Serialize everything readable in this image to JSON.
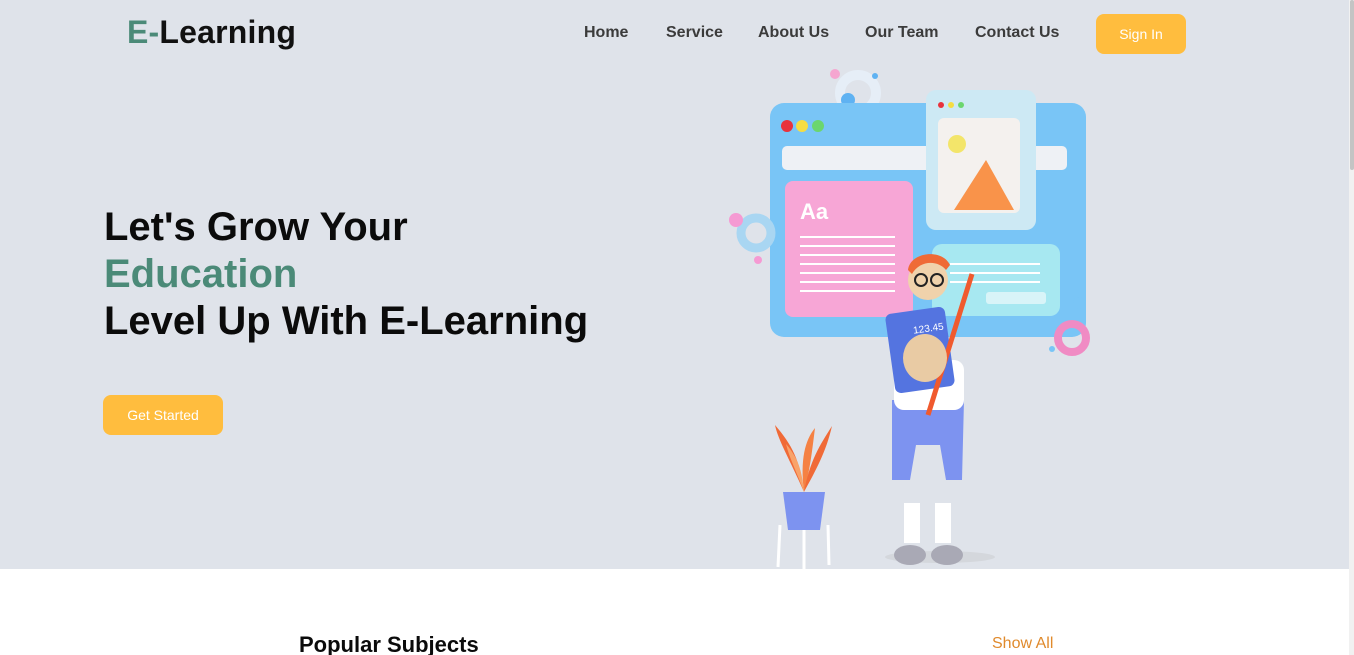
{
  "header": {
    "logo_prefix": "E-",
    "logo_rest": "Learning",
    "nav": [
      {
        "label": "Home"
      },
      {
        "label": "Service"
      },
      {
        "label": "About Us"
      },
      {
        "label": "Our Team"
      },
      {
        "label": "Contact Us"
      }
    ],
    "sign_in_label": "Sign In"
  },
  "hero": {
    "line1": "Let's Grow Your",
    "line2": "Education",
    "line3": "Level Up With E-Learning",
    "cta_label": "Get Started",
    "calculator_text": "123.45",
    "card_text": "Aa"
  },
  "subjects": {
    "title": "Popular Subjects",
    "show_all_label": "Show All"
  },
  "colors": {
    "accent_green": "#4b8a78",
    "button_yellow": "#ffbd3e",
    "hero_bg": "#dfe3ea",
    "link_orange": "#e08a2c"
  }
}
